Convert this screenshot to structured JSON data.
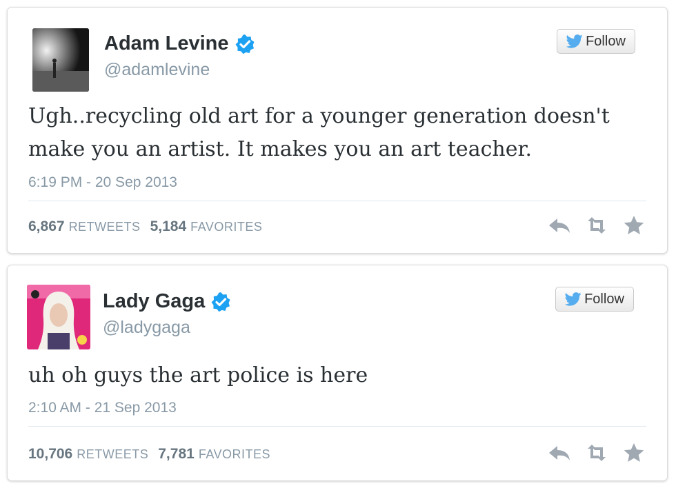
{
  "colors": {
    "verified_blue": "#1da1f2",
    "twitter_bird": "#55acee",
    "name_text": "#292f33",
    "muted_text": "#8899a6",
    "icon_gray": "#a0a9b2"
  },
  "tweets": [
    {
      "display_name": "Adam Levine",
      "handle": "@adamlevine",
      "verified": true,
      "follow_label": "Follow",
      "text": "Ugh..recycling old art for a younger generation doesn't make you an artist. It makes you an art teacher.",
      "timestamp": "6:19 PM - 20 Sep 2013",
      "retweets_count": "6,867",
      "retweets_label": "RETWEETS",
      "favorites_count": "5,184",
      "favorites_label": "FAVORITES",
      "icons": [
        "reply-icon",
        "retweet-icon",
        "favorite-icon"
      ]
    },
    {
      "display_name": "Lady Gaga",
      "handle": "@ladygaga",
      "verified": true,
      "follow_label": "Follow",
      "text": "uh oh guys the art police is here",
      "timestamp": "2:10 AM - 21 Sep 2013",
      "retweets_count": "10,706",
      "retweets_label": "RETWEETS",
      "favorites_count": "7,781",
      "favorites_label": "FAVORITES",
      "icons": [
        "reply-icon",
        "retweet-icon",
        "favorite-icon"
      ]
    }
  ]
}
